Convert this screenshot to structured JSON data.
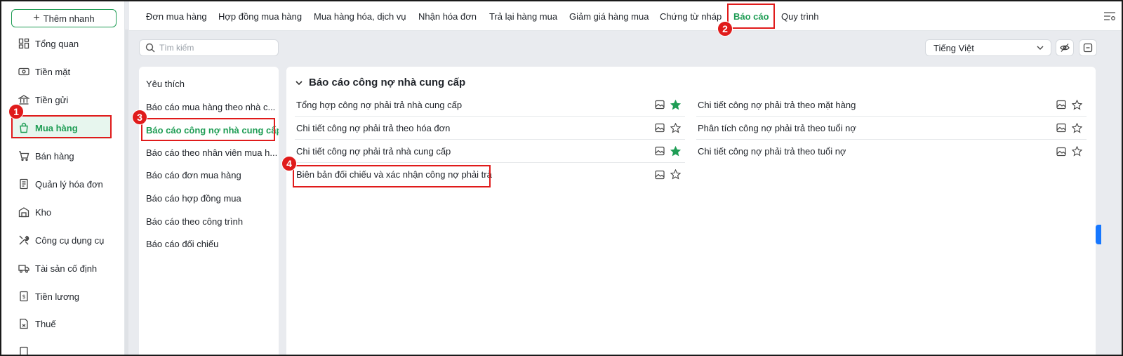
{
  "sidebar": {
    "add_label": "Thêm nhanh",
    "items": [
      {
        "label": "Tổng quan",
        "icon": "dashboard-icon"
      },
      {
        "label": "Tiền mặt",
        "icon": "cash-icon"
      },
      {
        "label": "Tiền gửi",
        "icon": "bank-icon"
      },
      {
        "label": "Mua hàng",
        "icon": "shopping-bag-icon"
      },
      {
        "label": "Bán hàng",
        "icon": "cart-icon"
      },
      {
        "label": "Quản lý hóa đơn",
        "icon": "invoice-icon"
      },
      {
        "label": "Kho",
        "icon": "warehouse-icon"
      },
      {
        "label": "Công cụ dụng cụ",
        "icon": "tools-icon"
      },
      {
        "label": "Tài sản cố định",
        "icon": "truck-icon"
      },
      {
        "label": "Tiền lương",
        "icon": "salary-icon"
      },
      {
        "label": "Thuế",
        "icon": "tax-icon"
      }
    ],
    "active": "Mua hàng"
  },
  "topnav": {
    "tabs": [
      {
        "label": "Đơn mua hàng"
      },
      {
        "label": "Hợp đồng mua hàng"
      },
      {
        "label": "Mua hàng hóa, dịch vụ"
      },
      {
        "label": "Nhận hóa đơn"
      },
      {
        "label": "Trả lại hàng mua"
      },
      {
        "label": "Giảm giá hàng mua"
      },
      {
        "label": "Chứng từ nháp"
      },
      {
        "label": "Báo cáo"
      },
      {
        "label": "Quy trình"
      }
    ],
    "active": "Báo cáo"
  },
  "toolbar": {
    "search_placeholder": "Tìm kiếm",
    "language": "Tiếng Việt"
  },
  "categories": {
    "items": [
      {
        "label": "Yêu thích"
      },
      {
        "label": "Báo cáo mua hàng theo nhà c..."
      },
      {
        "label": "Báo cáo công nợ nhà cung cấp"
      },
      {
        "label": "Báo cáo theo nhân viên mua h..."
      },
      {
        "label": "Báo cáo đơn mua hàng"
      },
      {
        "label": "Báo cáo hợp đồng mua"
      },
      {
        "label": "Báo cáo theo công trình"
      },
      {
        "label": "Báo cáo đối chiếu"
      }
    ],
    "active": "Báo cáo công nợ nhà cung cấp"
  },
  "reports": {
    "section_title": "Báo cáo công nợ nhà cung cấp",
    "left": [
      {
        "label": "Tổng hợp công nợ phải trả nhà cung cấp",
        "favorite": true
      },
      {
        "label": "Chi tiết công nợ phải trả theo hóa đơn",
        "favorite": false
      },
      {
        "label": "Chi tiết công nợ phải trả nhà cung cấp",
        "favorite": true
      },
      {
        "label": "Biên bản đối chiếu và xác nhận công nợ phải trả",
        "favorite": false
      }
    ],
    "right": [
      {
        "label": "Chi tiết công nợ phải trả theo mặt hàng",
        "favorite": false
      },
      {
        "label": "Phân tích công nợ phải trả theo tuổi nợ",
        "favorite": false
      },
      {
        "label": "Chi tiết công nợ phải trả theo tuổi nợ",
        "favorite": false
      }
    ]
  },
  "steps": [
    "1",
    "2",
    "3",
    "4"
  ],
  "colors": {
    "accent": "#1f9d55",
    "annotation": "#e01b1b",
    "star_fav": "#1f9d55"
  }
}
